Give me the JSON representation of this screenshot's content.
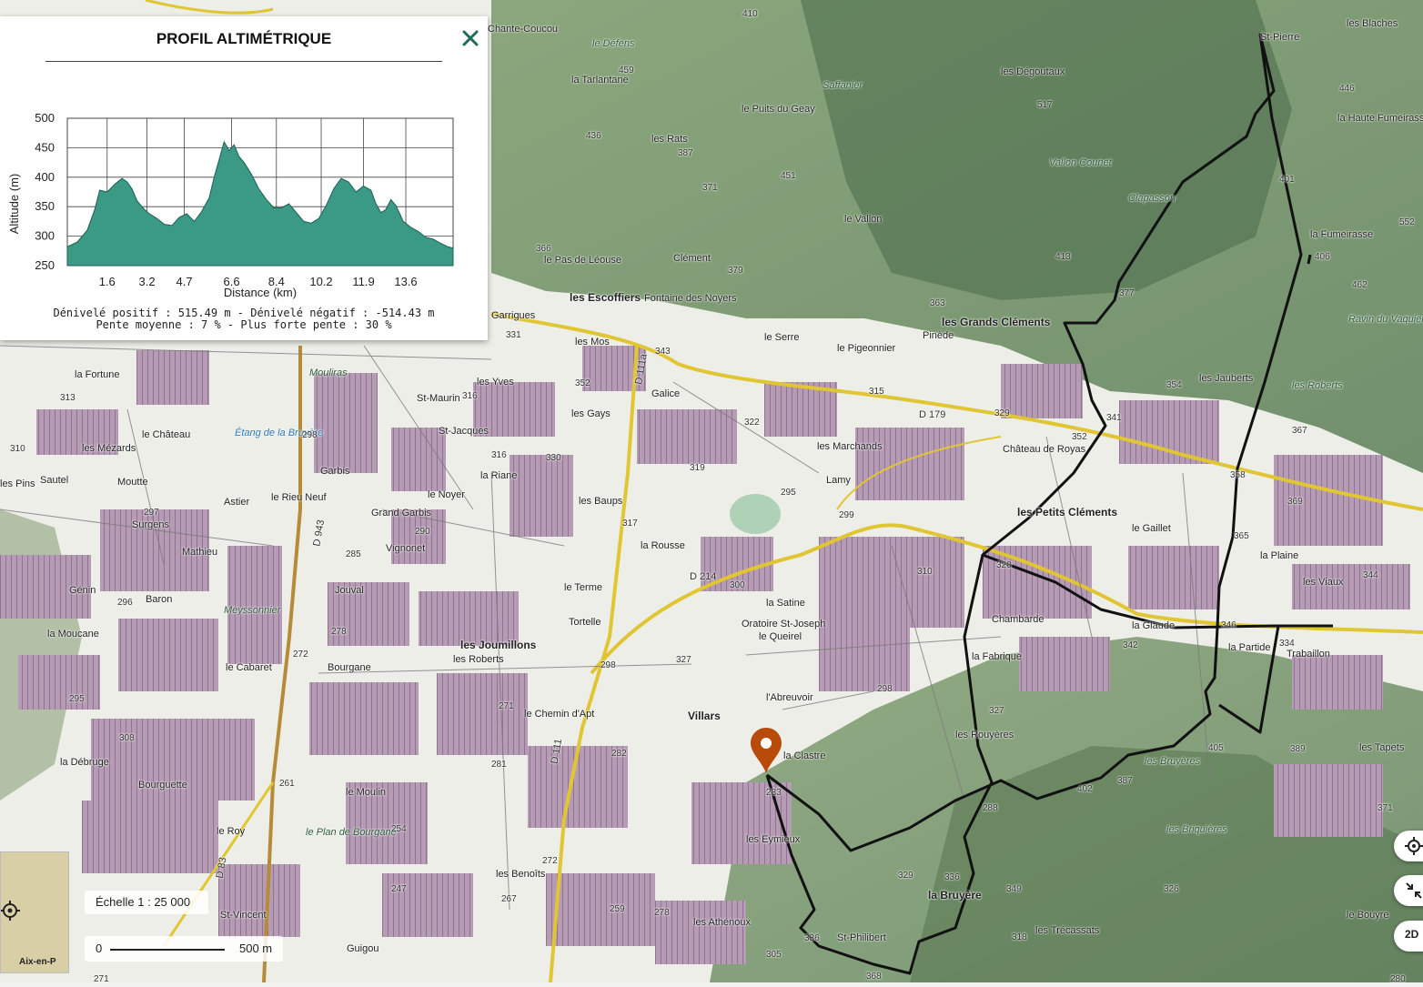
{
  "profile": {
    "title": "PROFIL ALTIMÉTRIQUE",
    "close_icon": "close-icon",
    "y_label": "Altitude (m)",
    "x_label": "Distance (km)",
    "stats_line1": "Dénivelé positif : 515.49 m - Dénivelé négatif : -514.43 m",
    "stats_line2": "Pente moyenne : 7 % - Plus forte pente : 30 %"
  },
  "chart_data": {
    "type": "area",
    "xlabel": "Distance (km)",
    "ylabel": "Altitude (m)",
    "ylim": [
      250,
      500
    ],
    "yticks": [
      250,
      300,
      350,
      400,
      450,
      500
    ],
    "xlim": [
      0,
      15.5
    ],
    "xticks": [
      1.6,
      3.2,
      4.7,
      6.6,
      8.4,
      10.2,
      11.9,
      13.6
    ],
    "xtick_labels": [
      "1.6",
      "3.2",
      "4.7",
      "6.6",
      "8.4",
      "10.2",
      "11.9",
      "13.6"
    ],
    "grid": true,
    "color": "#3a9a86",
    "x": [
      0,
      0.4,
      0.8,
      1.1,
      1.3,
      1.6,
      1.9,
      2.2,
      2.4,
      2.6,
      2.8,
      3.1,
      3.3,
      3.6,
      3.9,
      4.2,
      4.5,
      4.8,
      5.1,
      5.4,
      5.7,
      5.9,
      6.1,
      6.3,
      6.5,
      6.7,
      6.9,
      7.1,
      7.4,
      7.7,
      8.0,
      8.3,
      8.6,
      8.9,
      9.2,
      9.5,
      9.8,
      10.1,
      10.4,
      10.7,
      11.0,
      11.3,
      11.6,
      11.9,
      12.2,
      12.4,
      12.6,
      12.8,
      13.0,
      13.2,
      13.5,
      13.8,
      14.1,
      14.4,
      14.7,
      15.0,
      15.3,
      15.5
    ],
    "y": [
      282,
      290,
      310,
      345,
      378,
      375,
      388,
      398,
      392,
      380,
      360,
      345,
      338,
      330,
      320,
      318,
      332,
      338,
      325,
      342,
      365,
      400,
      430,
      460,
      445,
      455,
      435,
      425,
      405,
      380,
      362,
      348,
      348,
      355,
      340,
      325,
      322,
      330,
      352,
      380,
      398,
      392,
      375,
      385,
      378,
      355,
      340,
      345,
      362,
      352,
      325,
      315,
      308,
      298,
      295,
      288,
      282,
      280
    ]
  },
  "map": {
    "labels": [
      {
        "t": "Chante-Coucou",
        "c": ""
      },
      {
        "t": "le Défens",
        "c": "italic"
      },
      {
        "t": "la Tarlantane",
        "c": ""
      },
      {
        "t": "les Rats",
        "c": ""
      },
      {
        "t": "le Puits du Geay",
        "c": ""
      },
      {
        "t": "Saffanier",
        "c": "italic"
      },
      {
        "t": "les Dégoutaux",
        "c": ""
      },
      {
        "t": "St-Pierre",
        "c": ""
      },
      {
        "t": "les Blaches",
        "c": ""
      },
      {
        "t": "la Haute Fumeirasse",
        "c": ""
      },
      {
        "t": "Vallon Counet",
        "c": "italic"
      },
      {
        "t": "Clapasson",
        "c": "italic"
      },
      {
        "t": "la Fumeirasse",
        "c": ""
      },
      {
        "t": "le Vallon",
        "c": ""
      },
      {
        "t": "Clément",
        "c": ""
      },
      {
        "t": "le Pas de Léouse",
        "c": ""
      },
      {
        "t": "les Escoffiers",
        "c": "big"
      },
      {
        "t": "Fontaine des Noyers",
        "c": ""
      },
      {
        "t": "les Grands Cléments",
        "c": "big"
      },
      {
        "t": "Pinède",
        "c": ""
      },
      {
        "t": "Ravin du Vaquier",
        "c": "italic"
      },
      {
        "t": "les Roberts",
        "c": "italic"
      },
      {
        "t": "les Jauberts",
        "c": ""
      },
      {
        "t": "Garrigues",
        "c": ""
      },
      {
        "t": "les Mos",
        "c": ""
      },
      {
        "t": "le Serre",
        "c": ""
      },
      {
        "t": "le Pigeonnier",
        "c": ""
      },
      {
        "t": "la Fortune",
        "c": ""
      },
      {
        "t": "Mouliras",
        "c": "italic"
      },
      {
        "t": "St-Maurin",
        "c": ""
      },
      {
        "t": "les Yves",
        "c": ""
      },
      {
        "t": "Galice",
        "c": ""
      },
      {
        "t": "les Gays",
        "c": ""
      },
      {
        "t": "St-Jacques",
        "c": ""
      },
      {
        "t": "les Marchands",
        "c": ""
      },
      {
        "t": "Château de Royas",
        "c": ""
      },
      {
        "t": "le Château",
        "c": ""
      },
      {
        "t": "les Mézards",
        "c": ""
      },
      {
        "t": "Étang de la Bruyère",
        "c": "water"
      },
      {
        "t": "Garbis",
        "c": ""
      },
      {
        "t": "la Riane",
        "c": ""
      },
      {
        "t": "Lamy",
        "c": ""
      },
      {
        "t": "les Petits Cléments",
        "c": "big"
      },
      {
        "t": "le Gaillet",
        "c": ""
      },
      {
        "t": "les Pins",
        "c": ""
      },
      {
        "t": "Sautel",
        "c": ""
      },
      {
        "t": "Moutte",
        "c": ""
      },
      {
        "t": "Astier",
        "c": ""
      },
      {
        "t": "le Rieu Neuf",
        "c": ""
      },
      {
        "t": "le Noyer",
        "c": ""
      },
      {
        "t": "les Baups",
        "c": ""
      },
      {
        "t": "Grand Garbis",
        "c": ""
      },
      {
        "t": "Surgens",
        "c": ""
      },
      {
        "t": "Mathieu",
        "c": ""
      },
      {
        "t": "Vignonet",
        "c": ""
      },
      {
        "t": "la Rousse",
        "c": ""
      },
      {
        "t": "la Plaine",
        "c": ""
      },
      {
        "t": "les Viaux",
        "c": ""
      },
      {
        "t": "Génin",
        "c": ""
      },
      {
        "t": "Baron",
        "c": ""
      },
      {
        "t": "Jouval",
        "c": ""
      },
      {
        "t": "le Terme",
        "c": ""
      },
      {
        "t": "la Satine",
        "c": ""
      },
      {
        "t": "Meyssonnier",
        "c": "italic"
      },
      {
        "t": "Tortelle",
        "c": ""
      },
      {
        "t": "Oratoire St-Joseph",
        "c": ""
      },
      {
        "t": "le Queirel",
        "c": ""
      },
      {
        "t": "Chambarde",
        "c": ""
      },
      {
        "t": "la Glaude",
        "c": ""
      },
      {
        "t": "la Partide",
        "c": ""
      },
      {
        "t": "Trabaillon",
        "c": ""
      },
      {
        "t": "la Moucane",
        "c": ""
      },
      {
        "t": "les Joumillons",
        "c": "big"
      },
      {
        "t": "les Roberts",
        "c": ""
      },
      {
        "t": "le Cabaret",
        "c": ""
      },
      {
        "t": "Bourgane",
        "c": ""
      },
      {
        "t": "la Fabrique",
        "c": ""
      },
      {
        "t": "l'Abreuvoir",
        "c": ""
      },
      {
        "t": "Villars",
        "c": "big"
      },
      {
        "t": "le Chemin d'Apt",
        "c": ""
      },
      {
        "t": "les Rouyères",
        "c": ""
      },
      {
        "t": "la Débruge",
        "c": ""
      },
      {
        "t": "la Clastre",
        "c": ""
      },
      {
        "t": "les Bruyères",
        "c": "italic"
      },
      {
        "t": "les Tapets",
        "c": ""
      },
      {
        "t": "Bourguette",
        "c": ""
      },
      {
        "t": "le Moulin",
        "c": ""
      },
      {
        "t": "les Briquières",
        "c": "italic"
      },
      {
        "t": "le Roy",
        "c": ""
      },
      {
        "t": "le Plan de Bourgane",
        "c": "italic"
      },
      {
        "t": "les Eymieux",
        "c": ""
      },
      {
        "t": "les Benoîts",
        "c": ""
      },
      {
        "t": "la Bruyère",
        "c": "big"
      },
      {
        "t": "St-Vincent",
        "c": ""
      },
      {
        "t": "les Athénoux",
        "c": ""
      },
      {
        "t": "St-Philibert",
        "c": ""
      },
      {
        "t": "les Trécassats",
        "c": ""
      },
      {
        "t": "Guigou",
        "c": ""
      },
      {
        "t": "le Bouyre",
        "c": ""
      }
    ],
    "roads": [
      "D 111a",
      "D 179",
      "D 214",
      "D 943",
      "D 111",
      "D 83"
    ],
    "elevations": [
      "410",
      "459",
      "436",
      "387",
      "371",
      "451",
      "517",
      "446",
      "401",
      "406",
      "462",
      "552",
      "366",
      "379",
      "413",
      "377",
      "363",
      "343",
      "331",
      "352",
      "316",
      "330",
      "322",
      "315",
      "329",
      "354",
      "341",
      "367",
      "352",
      "358",
      "369",
      "313",
      "310",
      "298",
      "316",
      "319",
      "295",
      "299",
      "320",
      "365",
      "344",
      "297",
      "296",
      "290",
      "285",
      "317",
      "300",
      "310",
      "346",
      "334",
      "278",
      "272",
      "327",
      "298",
      "342",
      "295",
      "271",
      "282",
      "298",
      "327",
      "308",
      "281",
      "272",
      "283",
      "405",
      "402",
      "387",
      "389",
      "261",
      "254",
      "288",
      "329",
      "336",
      "349",
      "326",
      "371",
      "247",
      "267",
      "259",
      "278",
      "336",
      "305",
      "368",
      "318",
      "280",
      "271"
    ]
  },
  "scale": {
    "label": "Échelle 1 : 25 000",
    "zero": "0",
    "distance": "500 m"
  },
  "minimap": {
    "label": "Aix-en-P",
    "locate_icon": "crosshair-icon"
  },
  "controls": {
    "locate_icon": "locate-icon",
    "fullscreen_icon": "collapse-icon",
    "mode_label": "2D"
  }
}
